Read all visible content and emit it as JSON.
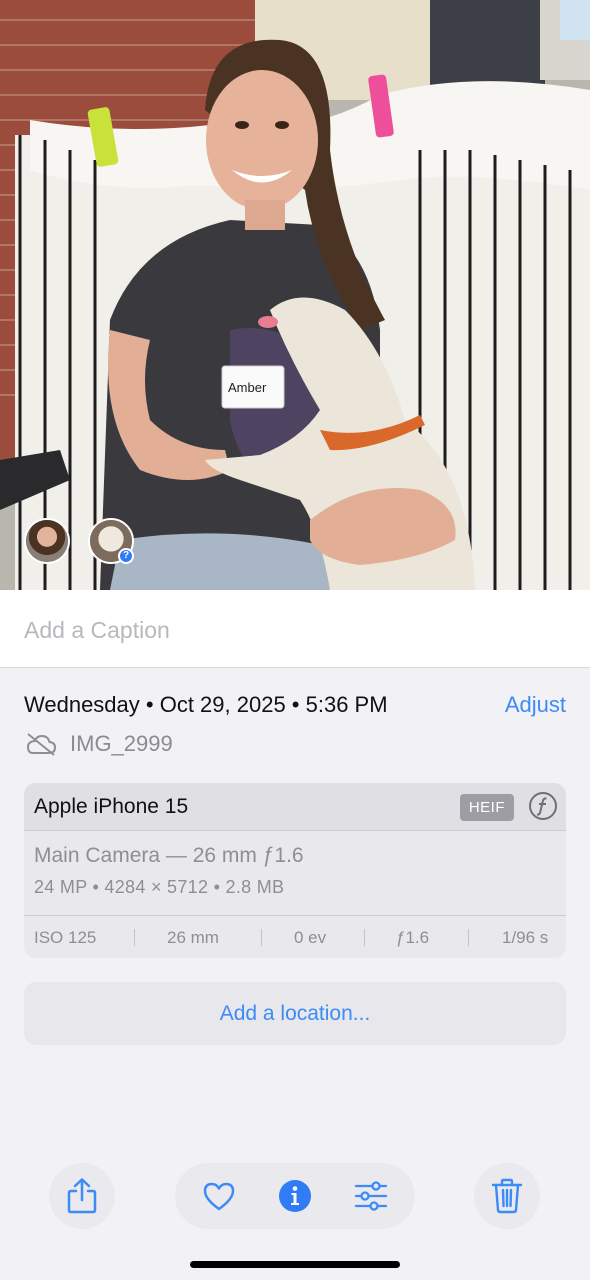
{
  "photo": {
    "name_tag": "Amber",
    "people_badge": "?"
  },
  "caption": {
    "placeholder": "Add a Caption"
  },
  "info": {
    "date_line": "Wednesday • Oct 29, 2025 • 5:36 PM",
    "adjust_label": "Adjust",
    "filename": "IMG_2999"
  },
  "camera": {
    "device": "Apple iPhone 15",
    "format_badge": "HEIF",
    "lens": "Main Camera — 26 mm ƒ1.6",
    "specs": "24 MP • 4284 × 5712 • 2.8 MB",
    "exif": [
      "ISO 125",
      "26 mm",
      "0 ev",
      "ƒ1.6",
      "1/96 s"
    ]
  },
  "location": {
    "label": "Add a location..."
  },
  "toolbar": {
    "icons": [
      "share-icon",
      "heart-icon",
      "info-icon",
      "adjust-sliders-icon",
      "trash-icon"
    ]
  },
  "colors": {
    "accent": "#3d8bf6",
    "secondary_text": "#8e8e93",
    "background": "#f2f2f6"
  }
}
